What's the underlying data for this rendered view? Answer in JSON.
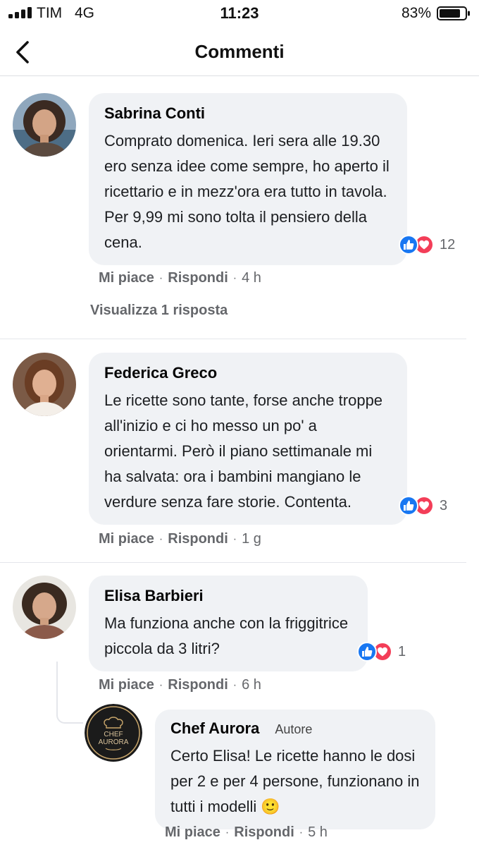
{
  "status_bar": {
    "carrier": "TIM",
    "network": "4G",
    "time": "11:23",
    "battery": "83%"
  },
  "header": {
    "title": "Commenti"
  },
  "comments": [
    {
      "author": "Sabrina Conti",
      "text": "Comprato domenica. Ieri sera alle 19.30 ero senza idee come sempre, ho aperto il ricettario e in mezz'ora era tutto in tavola. Per 9,99 mi sono tolta il pensiero della cena.",
      "reaction_count": "12",
      "like_label": "Mi piace",
      "reply_label": "Rispondi",
      "time": "4 h",
      "view_replies": "Visualizza 1 risposta"
    },
    {
      "author": "Federica Greco",
      "text": "Le ricette sono tante, forse anche troppe all'inizio e ci ho messo un po' a orientarmi. Però il piano settimanale mi ha salvata: ora i bambini mangiano le verdure senza fare storie. Contenta.",
      "reaction_count": "3",
      "like_label": "Mi piace",
      "reply_label": "Rispondi",
      "time": "1 g"
    },
    {
      "author": "Elisa Barbieri",
      "text": "Ma funziona anche con la friggitrice piccola da 3 litri?",
      "reaction_count": "1",
      "like_label": "Mi piace",
      "reply_label": "Rispondi",
      "time": "6 h"
    }
  ],
  "reply": {
    "author": "Chef Aurora",
    "badge": "Autore",
    "avatar_line1": "CHEF",
    "avatar_line2": "AURORA",
    "text": "Certo Elisa! Le ricette hanno le dosi per 2 e per 4 persone, funzionano in tutti i modelli 🙂",
    "like_label": "Mi piace",
    "reply_label": "Rispondi",
    "time": "5 h"
  },
  "colors": {
    "like": "#1877f2",
    "love": "#f33e58",
    "bubble": "#f0f2f5",
    "meta": "#65676b"
  }
}
